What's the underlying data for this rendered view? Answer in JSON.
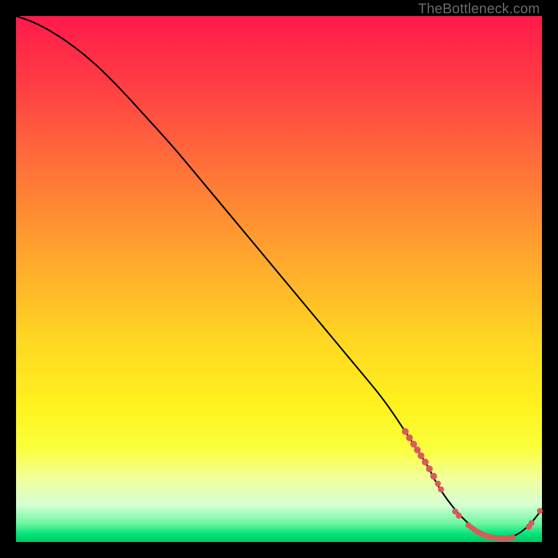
{
  "watermark": "TheBottleneck.com",
  "chart_data": {
    "type": "line",
    "title": "",
    "xlabel": "",
    "ylabel": "",
    "xlim": [
      0,
      100
    ],
    "ylim": [
      0,
      100
    ],
    "series": [
      {
        "name": "bottleneck-curve",
        "x": [
          0,
          3,
          6,
          10,
          15,
          20,
          25,
          30,
          35,
          40,
          45,
          50,
          55,
          60,
          65,
          70,
          74,
          78,
          80,
          82,
          84,
          86,
          88,
          90,
          92,
          94,
          96,
          98,
          100
        ],
        "values": [
          100,
          99,
          97.5,
          95,
          91,
          86,
          80.5,
          75,
          69,
          63,
          57,
          51,
          45,
          39,
          33,
          27,
          21,
          15,
          11,
          8,
          5.5,
          3.5,
          2,
          1,
          0.7,
          0.8,
          1.8,
          3.6,
          6.2
        ]
      }
    ],
    "highlight_points": {
      "name": "marker-cluster",
      "color": "#d95a5a",
      "points": [
        {
          "x": 74.0,
          "y": 21.0,
          "r": 3.2
        },
        {
          "x": 74.8,
          "y": 19.8,
          "r": 3.2
        },
        {
          "x": 75.6,
          "y": 18.6,
          "r": 3.2
        },
        {
          "x": 76.3,
          "y": 17.5,
          "r": 3.2
        },
        {
          "x": 77.0,
          "y": 16.4,
          "r": 3.2
        },
        {
          "x": 77.8,
          "y": 15.2,
          "r": 3.2
        },
        {
          "x": 78.6,
          "y": 13.9,
          "r": 3.2
        },
        {
          "x": 79.4,
          "y": 12.5,
          "r": 3.2
        },
        {
          "x": 80.2,
          "y": 11.1,
          "r": 2.6
        },
        {
          "x": 80.8,
          "y": 10.0,
          "r": 2.6
        },
        {
          "x": 83.5,
          "y": 5.8,
          "r": 2.6
        },
        {
          "x": 84.2,
          "y": 5.0,
          "r": 2.6
        },
        {
          "x": 86.0,
          "y": 3.2,
          "r": 2.4
        },
        {
          "x": 86.6,
          "y": 2.7,
          "r": 2.4
        },
        {
          "x": 87.2,
          "y": 2.3,
          "r": 2.4
        },
        {
          "x": 87.8,
          "y": 1.9,
          "r": 2.4
        },
        {
          "x": 88.4,
          "y": 1.6,
          "r": 2.4
        },
        {
          "x": 89.0,
          "y": 1.3,
          "r": 2.4
        },
        {
          "x": 89.6,
          "y": 1.1,
          "r": 2.4
        },
        {
          "x": 90.2,
          "y": 0.95,
          "r": 2.4
        },
        {
          "x": 90.8,
          "y": 0.85,
          "r": 2.4
        },
        {
          "x": 91.4,
          "y": 0.78,
          "r": 2.4
        },
        {
          "x": 92.0,
          "y": 0.72,
          "r": 2.4
        },
        {
          "x": 92.6,
          "y": 0.7,
          "r": 2.4
        },
        {
          "x": 93.2,
          "y": 0.72,
          "r": 2.4
        },
        {
          "x": 93.8,
          "y": 0.78,
          "r": 2.4
        },
        {
          "x": 94.4,
          "y": 0.9,
          "r": 2.4
        },
        {
          "x": 97.5,
          "y": 2.9,
          "r": 2.6
        },
        {
          "x": 98.0,
          "y": 3.6,
          "r": 2.6
        },
        {
          "x": 99.6,
          "y": 5.9,
          "r": 2.4
        }
      ]
    }
  }
}
